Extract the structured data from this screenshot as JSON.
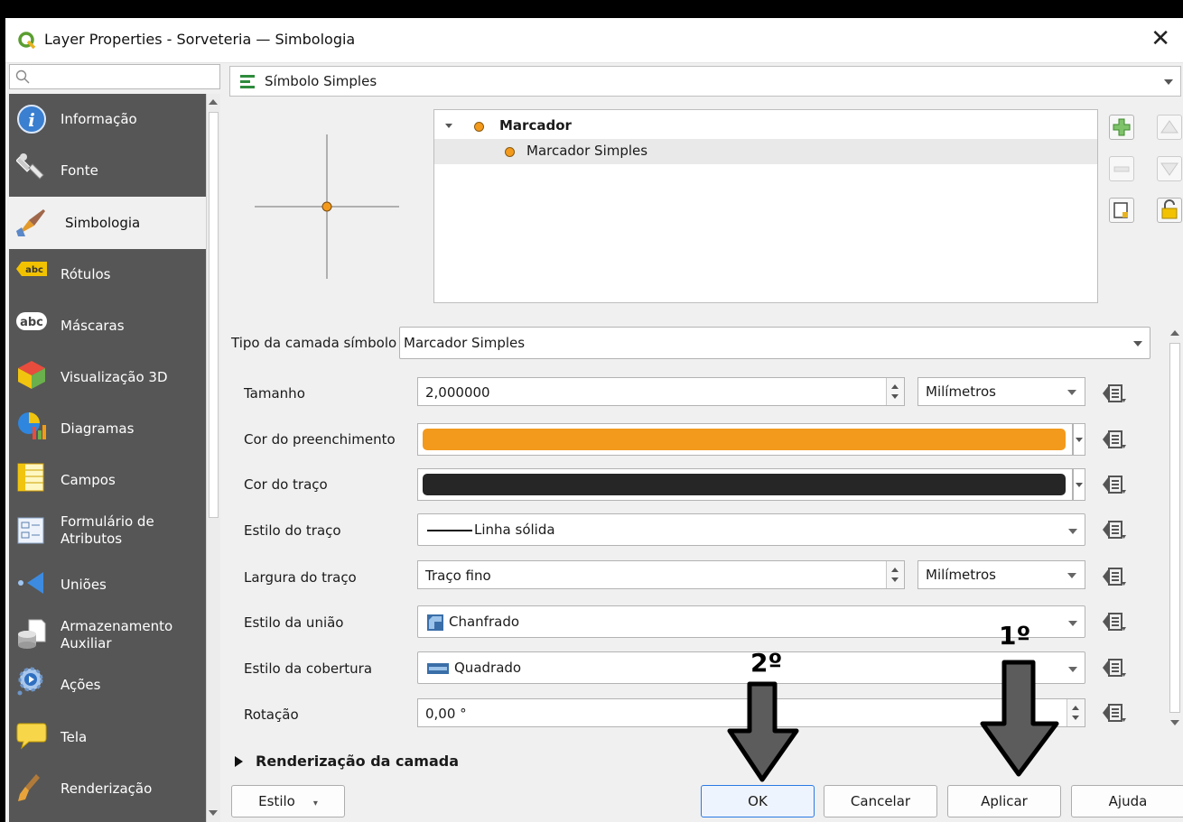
{
  "window": {
    "title": "Layer Properties - Sorveteria — Simbologia"
  },
  "sidebar": {
    "items": [
      {
        "label": "Informação",
        "icon": "info-icon"
      },
      {
        "label": "Fonte",
        "icon": "source-icon"
      },
      {
        "label": "Simbologia",
        "icon": "symbology-icon",
        "active": true
      },
      {
        "label": "Rótulos",
        "icon": "labels-icon"
      },
      {
        "label": "Máscaras",
        "icon": "masks-icon"
      },
      {
        "label": "Visualização 3D",
        "icon": "3d-view-icon"
      },
      {
        "label": "Diagramas",
        "icon": "diagrams-icon"
      },
      {
        "label": "Campos",
        "icon": "fields-icon"
      },
      {
        "label": "Formulário de\nAtributos",
        "icon": "attributes-form-icon"
      },
      {
        "label": "Uniões",
        "icon": "joins-icon"
      },
      {
        "label": "Armazenamento\nAuxiliar",
        "icon": "auxiliary-storage-icon"
      },
      {
        "label": "Ações",
        "icon": "actions-icon"
      },
      {
        "label": "Tela",
        "icon": "display-icon"
      },
      {
        "label": "Renderização",
        "icon": "rendering-icon"
      }
    ]
  },
  "renderer": {
    "label": "Símbolo Simples"
  },
  "symbol_tree": {
    "root": "Marcador",
    "child": "Marcador Simples"
  },
  "symbol_layer_type": {
    "label": "Tipo da camada símbolo",
    "value": "Marcador Simples"
  },
  "properties": {
    "size": {
      "label": "Tamanho",
      "value": "2,000000",
      "unit": "Milímetros"
    },
    "fill_color": {
      "label": "Cor do preenchimento",
      "color": "#f39a1c"
    },
    "stroke_color": {
      "label": "Cor do traço",
      "color": "#262626"
    },
    "stroke_style": {
      "label": "Estilo do traço",
      "value": "Linha sólida"
    },
    "stroke_width": {
      "label": "Largura do traço",
      "value": "Traço fino",
      "unit": "Milímetros"
    },
    "join_style": {
      "label": "Estilo da união",
      "value": "Chanfrado"
    },
    "cap_style": {
      "label": "Estilo da cobertura",
      "value": "Quadrado"
    },
    "rotation": {
      "label": "Rotação",
      "value": "0,00 °"
    }
  },
  "section": {
    "label": "Renderização da camada"
  },
  "buttons": {
    "style": "Estilo",
    "ok": "OK",
    "cancel": "Cancelar",
    "apply": "Aplicar",
    "help": "Ajuda"
  },
  "annotations": {
    "first": "1º",
    "second": "2º"
  }
}
